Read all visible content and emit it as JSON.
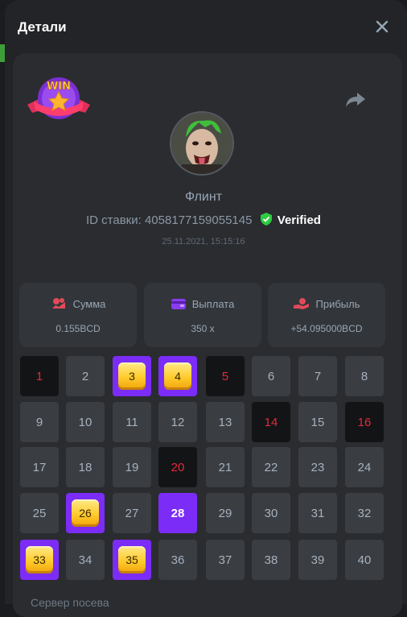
{
  "dialog": {
    "title": "Детали",
    "close_icon": "close-icon"
  },
  "win_badge": {
    "text": "WIN"
  },
  "user": {
    "name": "Флинт"
  },
  "bet": {
    "id_label": "ID ставки: 4058177159055145",
    "verified": "Verified",
    "date": "25.11.2021, 15:15:16"
  },
  "stats": [
    {
      "icon": "money-icon",
      "label": "Сумма",
      "value": "0.155BCD"
    },
    {
      "icon": "wallet-icon",
      "label": "Выплата",
      "value": "350 x"
    },
    {
      "icon": "hand-coin-icon",
      "label": "Прибыль",
      "value": "+54.095000BCD"
    }
  ],
  "colors": {
    "red": "#e12a3a",
    "purple": "#7c2cf7",
    "gold": "#ffcb2c",
    "verified": "#2ecc40"
  },
  "grid": [
    {
      "n": "1",
      "state": "red"
    },
    {
      "n": "2",
      "state": "normal"
    },
    {
      "n": "3",
      "state": "gem"
    },
    {
      "n": "4",
      "state": "gem"
    },
    {
      "n": "5",
      "state": "red"
    },
    {
      "n": "6",
      "state": "normal"
    },
    {
      "n": "7",
      "state": "normal"
    },
    {
      "n": "8",
      "state": "normal"
    },
    {
      "n": "9",
      "state": "normal"
    },
    {
      "n": "10",
      "state": "normal"
    },
    {
      "n": "11",
      "state": "normal"
    },
    {
      "n": "12",
      "state": "normal"
    },
    {
      "n": "13",
      "state": "normal"
    },
    {
      "n": "14",
      "state": "red"
    },
    {
      "n": "15",
      "state": "normal"
    },
    {
      "n": "16",
      "state": "red"
    },
    {
      "n": "17",
      "state": "normal"
    },
    {
      "n": "18",
      "state": "normal"
    },
    {
      "n": "19",
      "state": "normal"
    },
    {
      "n": "20",
      "state": "red"
    },
    {
      "n": "21",
      "state": "normal"
    },
    {
      "n": "22",
      "state": "normal"
    },
    {
      "n": "23",
      "state": "normal"
    },
    {
      "n": "24",
      "state": "normal"
    },
    {
      "n": "25",
      "state": "normal"
    },
    {
      "n": "26",
      "state": "gem"
    },
    {
      "n": "27",
      "state": "normal"
    },
    {
      "n": "28",
      "state": "purple"
    },
    {
      "n": "29",
      "state": "normal"
    },
    {
      "n": "30",
      "state": "normal"
    },
    {
      "n": "31",
      "state": "normal"
    },
    {
      "n": "32",
      "state": "normal"
    },
    {
      "n": "33",
      "state": "gem"
    },
    {
      "n": "34",
      "state": "normal"
    },
    {
      "n": "35",
      "state": "gem"
    },
    {
      "n": "36",
      "state": "normal"
    },
    {
      "n": "37",
      "state": "normal"
    },
    {
      "n": "38",
      "state": "normal"
    },
    {
      "n": "39",
      "state": "normal"
    },
    {
      "n": "40",
      "state": "normal"
    }
  ],
  "footer": {
    "text": "Сервер посева"
  }
}
